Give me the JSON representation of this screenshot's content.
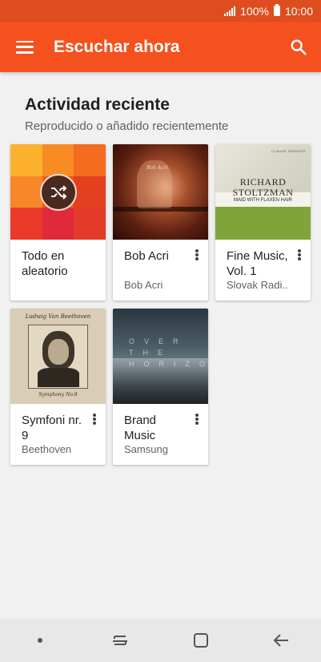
{
  "status": {
    "battery": "100%",
    "time": "10:00"
  },
  "app_bar": {
    "title": "Escuchar ahora"
  },
  "section": {
    "title": "Actividad reciente",
    "subtitle": "Reproducido o añadido recientemente"
  },
  "cards": [
    {
      "title": "Todo en aleatorio",
      "subtitle": ""
    },
    {
      "title": "Bob Acri",
      "subtitle": "Bob Acri",
      "art_text": "Bob Acri"
    },
    {
      "title": "Fine Music, Vol. 1",
      "subtitle": "Slovak Radi..",
      "art_line1": "RICHARD",
      "art_line2": "STOLTZMAN",
      "art_line3": "MAID WITH FLAXEN HAIR",
      "art_top": "CLAUDE DEBUSSY"
    },
    {
      "title": "Symfoni nr. 9",
      "subtitle": "Beethoven",
      "art_top": "Ludwig Van Beethoven",
      "art_bottom": "Symphony No.9"
    },
    {
      "title": "Brand Music",
      "subtitle": "Samsung",
      "art_text": "OVER THE HORIZON"
    }
  ],
  "colors": {
    "status_bar": "#de4d1f",
    "app_bar": "#f4511e",
    "background": "#f1f1f1"
  },
  "icons": {
    "menu": "hamburger-icon",
    "search": "search-icon",
    "shuffle": "shuffle-icon",
    "more": "more-vert-icon"
  }
}
